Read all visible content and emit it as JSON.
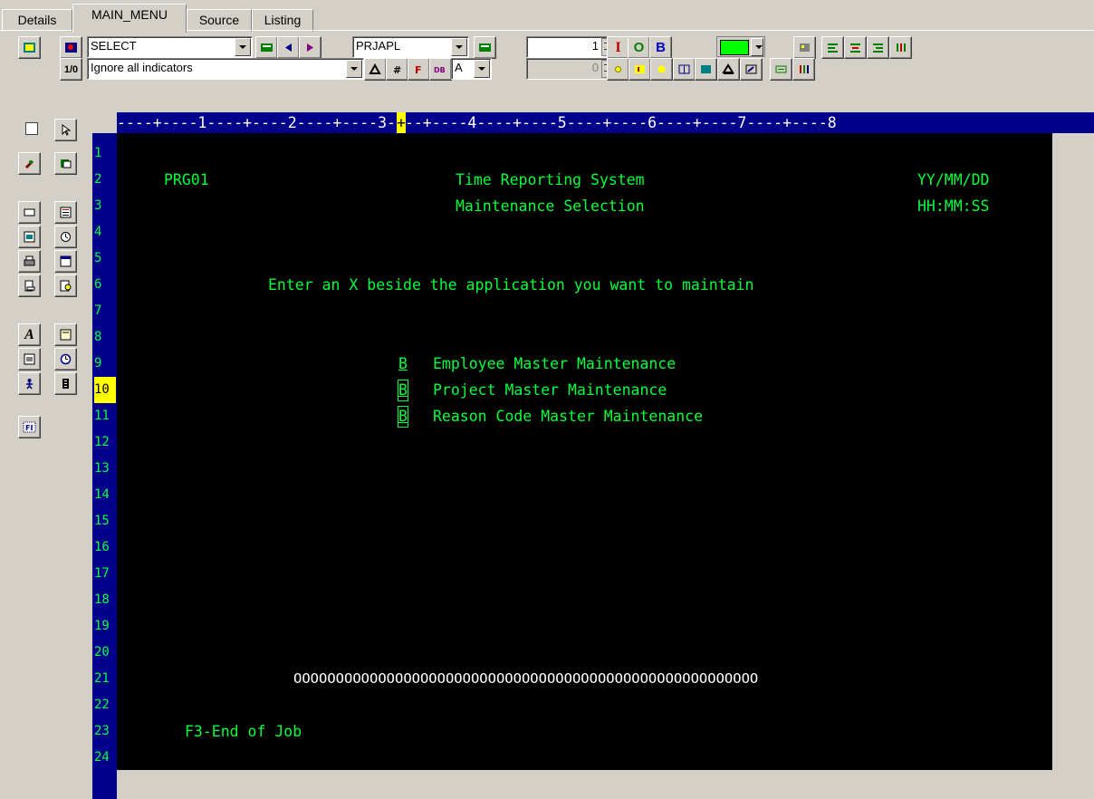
{
  "tabs": [
    "Details",
    "MAIN_MENU",
    "Source",
    "Listing"
  ],
  "toolbar": {
    "operation_select": "SELECT",
    "record_format": "PRJAPL",
    "spin_value": "1",
    "io_buttons": [
      "I",
      "O",
      "B"
    ],
    "indicator_label": "1/0",
    "indicator_select": "Ignore all indicators",
    "attr_select": "A",
    "spin_value_2": "0"
  },
  "ruler": "----+----1----+----2----+----3----+----4----+----5----+----6----+----7----+----8",
  "line_numbers": [
    "1",
    "2",
    "3",
    "4",
    "5",
    "6",
    "7",
    "8",
    "9",
    "10",
    "11",
    "12",
    "13",
    "14",
    "15",
    "16",
    "17",
    "18",
    "19",
    "20",
    "21",
    "22",
    "23",
    "24"
  ],
  "current_line": "10",
  "screen": {
    "program": "PRG01",
    "title": "Time Reporting System",
    "subtitle": "Maintenance Selection",
    "date": "YY/MM/DD",
    "time": "HH:MM:SS",
    "instruction": "Enter an X beside the application you want to maintain",
    "options": [
      {
        "field": "B",
        "label": "Employee Master Maintenance"
      },
      {
        "field": "B",
        "label": "Project Master Maintenance"
      },
      {
        "field": "B",
        "label": "Reason Code Master Maintenance"
      }
    ],
    "message_field": "OOOOOOOOOOOOOOOOOOOOOOOOOOOOOOOOOOOOOOOOOOOOOOOOOOOOOOO",
    "function_keys": "F3-End of Job"
  },
  "colors": {
    "screen_bg": "#000000",
    "screen_text": "#00ff3c",
    "ruler_bg": "#00008b",
    "highlight": "#ffff00"
  }
}
